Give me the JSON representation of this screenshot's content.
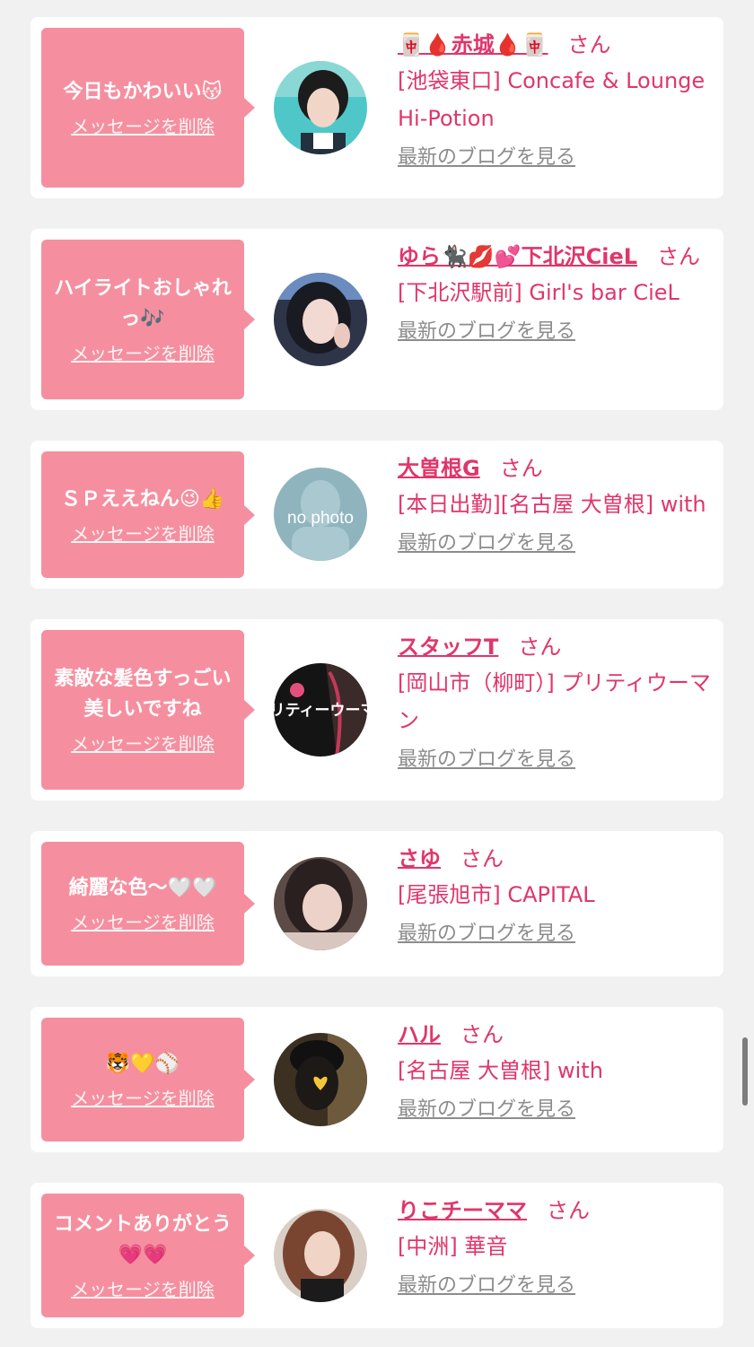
{
  "colors": {
    "page_bg": "#f1f1f2",
    "card_bg": "#ffffff",
    "bubble_bg": "#f58f9f",
    "accent_pink": "#e0366a",
    "blog_link_gray": "#8c8c8c"
  },
  "common": {
    "delete_label": "メッセージを削除",
    "blog_label": "最新のブログを見る",
    "honorific": "さん"
  },
  "messages": [
    {
      "message": "今日もかわいい😽",
      "name": "🀄🩸赤城🩸🀄",
      "shop": "[池袋東口] Concafe & Lounge Hi-Potion",
      "avatar_icon": "avatar-photo-icon"
    },
    {
      "message": "ハイライトおしゃれっ🎶",
      "name": "ゆら🐈‍⬛💋💕下北沢CieL",
      "shop": "[下北沢駅前] Girl's bar CieL",
      "avatar_icon": "avatar-photo-icon"
    },
    {
      "message": "ＳＰええねん😉👍",
      "name": "大曽根G",
      "shop": "[本日出勤][名古屋 大曽根] with",
      "avatar_icon": "no-photo-icon",
      "avatar_text": "no photo"
    },
    {
      "message": "素敵な髪色すっごい美しいですね",
      "name": "スタッフT",
      "shop": "[岡山市（柳町）] プリティウーマン",
      "avatar_icon": "avatar-logo-icon",
      "avatar_text": "プリティーウーマ"
    },
    {
      "message": "綺麗な色〜🤍🤍",
      "name": "さゆ",
      "shop": "[尾張旭市] CAPITAL",
      "avatar_icon": "avatar-photo-icon"
    },
    {
      "message": "🐯💛⚾",
      "name": "ハル",
      "shop": "[名古屋 大曽根] with",
      "avatar_icon": "avatar-photo-icon"
    },
    {
      "message": "コメントありがとう💗💗",
      "name": "りこチーママ",
      "shop": "[中洲] 華音",
      "avatar_icon": "avatar-photo-icon"
    }
  ]
}
